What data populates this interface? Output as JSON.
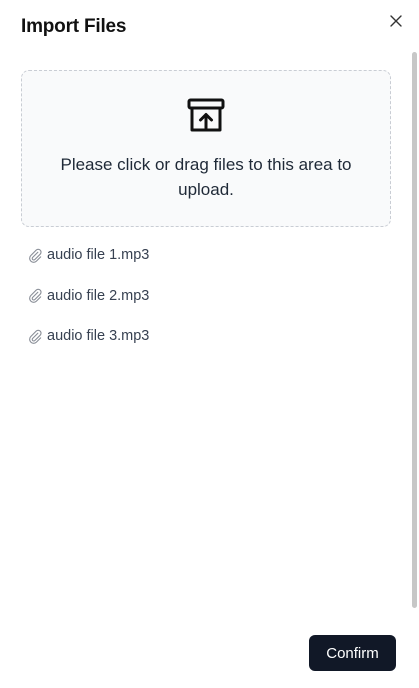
{
  "dialog": {
    "title": "Import Files",
    "close_icon": "close-icon"
  },
  "dropzone": {
    "icon": "archive-upload-icon",
    "text": "Please click or drag files to this area to upload."
  },
  "files": [
    {
      "name": "audio file 1.mp3",
      "icon": "paperclip-icon"
    },
    {
      "name": "audio file 2.mp3",
      "icon": "paperclip-icon"
    },
    {
      "name": "audio file 3.mp3",
      "icon": "paperclip-icon"
    }
  ],
  "footer": {
    "confirm_label": "Confirm"
  },
  "colors": {
    "primary_button": "#111827",
    "dropzone_bg": "#f9fafb",
    "dropzone_border": "#c9cdd4"
  }
}
